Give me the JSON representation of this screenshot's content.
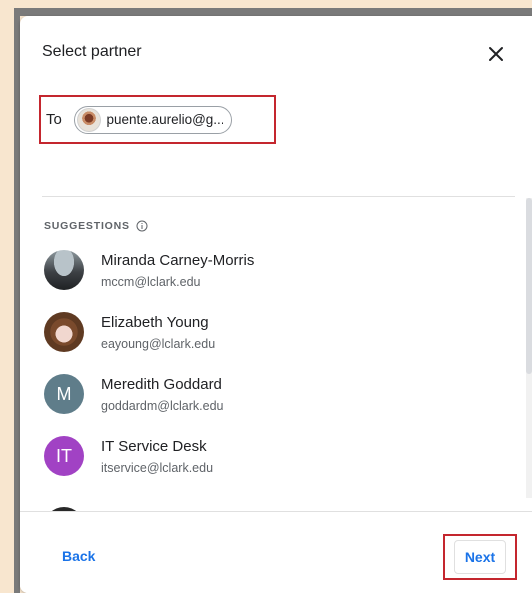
{
  "dialog": {
    "title": "Select partner",
    "close_icon": "close-icon"
  },
  "to": {
    "label": "To",
    "chip_text": "puente.aurelio@g..."
  },
  "suggestions": {
    "heading": "SUGGESTIONS",
    "info_icon": "info-icon",
    "items": [
      {
        "name": "Miranda Carney-Morris",
        "email": "mccm@lclark.edu",
        "avatar": "photo"
      },
      {
        "name": "Elizabeth Young",
        "email": "eayoung@lclark.edu",
        "avatar": "photo"
      },
      {
        "name": "Meredith Goddard",
        "email": "goddardm@lclark.edu",
        "avatar_letter": "M",
        "avatar_color": "#5f7d8a"
      },
      {
        "name": "IT Service Desk",
        "email": "itservice@lclark.edu",
        "avatar_letter": "IT",
        "avatar_color": "#a142c4"
      }
    ]
  },
  "footer": {
    "back_label": "Back",
    "next_label": "Next"
  },
  "colors": {
    "accent": "#1a73e8",
    "highlight_border": "#c4262e",
    "background": "#f8e6cf"
  }
}
